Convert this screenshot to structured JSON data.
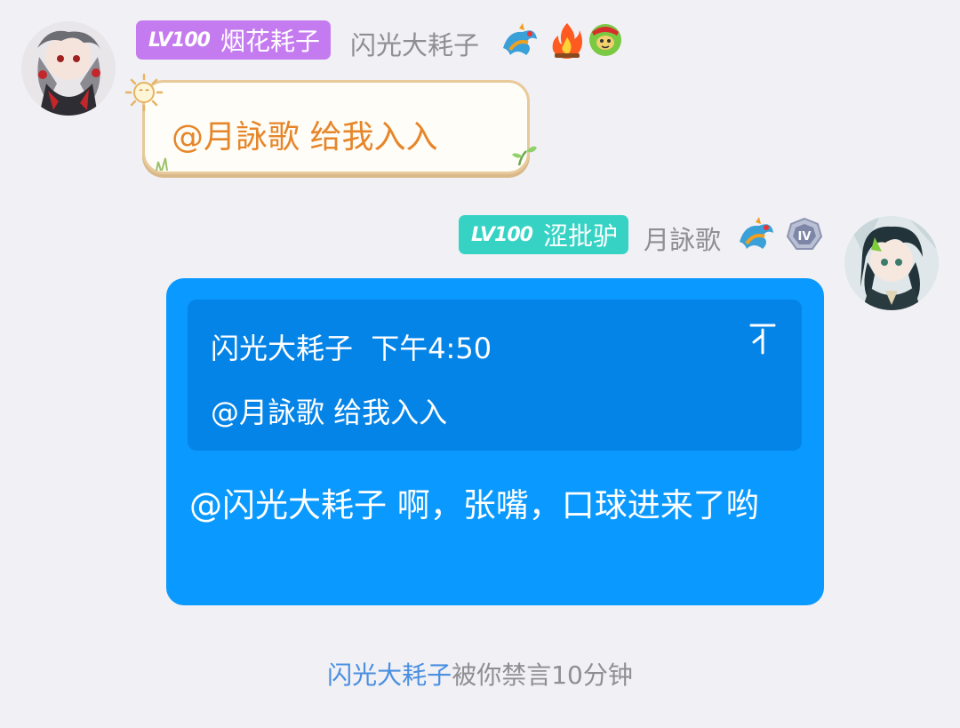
{
  "messages": [
    {
      "sender": {
        "level": "LV100",
        "title": "烟花耗子",
        "nickname": "闪光大耗子",
        "badge_color": "#c57bf0",
        "icons": [
          "dragon-icon",
          "fire-icon",
          "green-face-icon"
        ]
      },
      "text": "@月詠歌 给我入入",
      "text_color": "#e6862a"
    },
    {
      "sender": {
        "level": "LV100",
        "title": "涩批驴",
        "nickname": "月詠歌",
        "badge_color": "#36d3c5",
        "icons": [
          "dragon-icon",
          "rank-iv-icon"
        ]
      },
      "quote": {
        "author": "闪光大耗子",
        "time": "下午4:50",
        "text": "@月詠歌 给我入入"
      },
      "text": "@闪光大耗子 啊，张嘴，口球进来了哟",
      "bubble_color": "#0a99ff"
    }
  ],
  "system_notice": {
    "name": "闪光大耗子",
    "text": "被你禁言10分钟"
  }
}
